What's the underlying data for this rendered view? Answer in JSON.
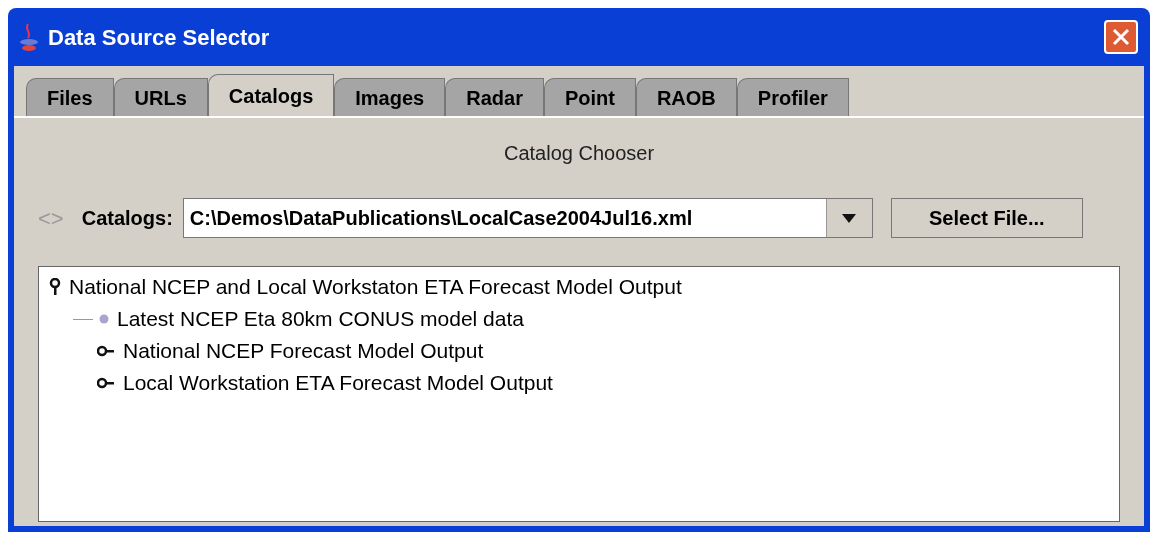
{
  "window": {
    "title": "Data Source Selector"
  },
  "tabs": [
    {
      "label": "Files",
      "selected": false
    },
    {
      "label": "URLs",
      "selected": false
    },
    {
      "label": "Catalogs",
      "selected": true
    },
    {
      "label": "Images",
      "selected": false
    },
    {
      "label": "Radar",
      "selected": false
    },
    {
      "label": "Point",
      "selected": false
    },
    {
      "label": "RAOB",
      "selected": false
    },
    {
      "label": "Profiler",
      "selected": false
    }
  ],
  "panel_title": "Catalog Chooser",
  "catalog_row": {
    "nav": "<>",
    "label": "Catalogs:",
    "value": "C:\\Demos\\DataPublications\\LocalCase2004Jul16.xml",
    "button": "Select File..."
  },
  "tree": [
    {
      "label": "National NCEP and Local Workstaton ETA Forecast Model Output",
      "kind": "folder",
      "expanded": true,
      "children": [
        {
          "label": "Latest NCEP Eta 80km CONUS model data",
          "kind": "leaf"
        },
        {
          "label": "National NCEP Forecast Model Output",
          "kind": "folder",
          "expanded": false
        },
        {
          "label": "Local Workstation ETA Forecast Model Output",
          "kind": "folder",
          "expanded": false
        }
      ]
    }
  ]
}
